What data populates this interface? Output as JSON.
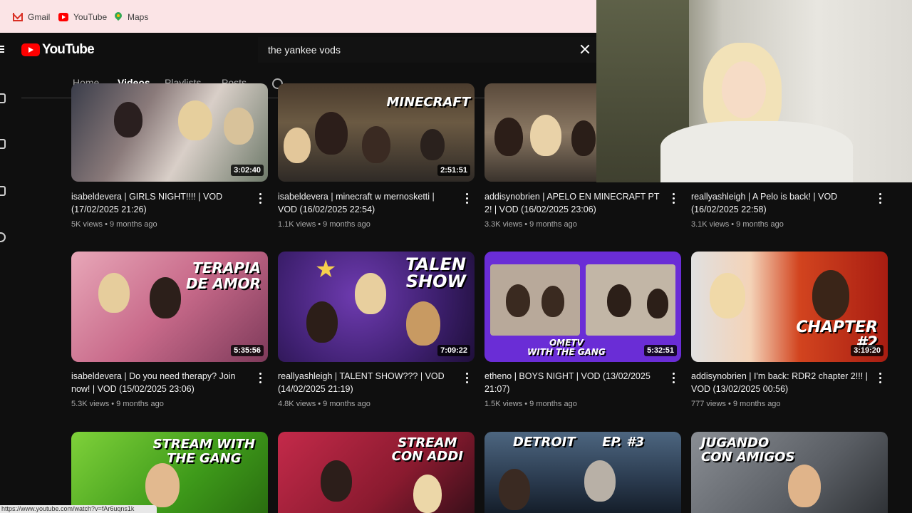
{
  "bookmarks": [
    {
      "label": "Gmail",
      "icon": "gmail-icon"
    },
    {
      "label": "YouTube",
      "icon": "youtube-icon"
    },
    {
      "label": "Maps",
      "icon": "maps-icon"
    }
  ],
  "header": {
    "logo_text": "YouTube",
    "search_value": "the yankee vods"
  },
  "tabs": [
    "Home",
    "Videos",
    "Playlists",
    "Posts"
  ],
  "active_tab": "Videos",
  "videos": [
    {
      "title": "isabeldevera | GIRLS NIGHT!!!! | VOD (17/02/2025 21:26)",
      "views": "5K views",
      "age": "9 months ago",
      "duration": "3:02:40",
      "thumb_text": ""
    },
    {
      "title": "isabeldevera | minecraft w mernosketti | VOD (16/02/2025 22:54)",
      "views": "1.1K views",
      "age": "9 months ago",
      "duration": "2:51:51",
      "thumb_text": "MINECRAFT"
    },
    {
      "title": "addisynobrien | APELO EN MINECRAFT PT 2! | VOD (16/02/2025 23:06)",
      "views": "3.3K views",
      "age": "9 months ago",
      "duration": "",
      "thumb_text": ""
    },
    {
      "title": "reallyashleigh | A Pelo is back! | VOD (16/02/2025 22:58)",
      "views": "3.1K views",
      "age": "9 months ago",
      "duration": "",
      "thumb_text": ""
    },
    {
      "title": "isabeldevera | Do you need therapy? Join now! | VOD (15/02/2025 23:06)",
      "views": "5.3K views",
      "age": "9 months ago",
      "duration": "5:35:56",
      "thumb_text": "TERAPIA\nDE AMOR"
    },
    {
      "title": "reallyashleigh | TALENT SHOW??? | VOD (14/02/2025 21:19)",
      "views": "4.8K views",
      "age": "9 months ago",
      "duration": "7:09:22",
      "thumb_text": "TALEN\nSHOW"
    },
    {
      "title": "etheno | BOYS NIGHT | VOD (13/02/2025 21:07)",
      "views": "1.5K views",
      "age": "9 months ago",
      "duration": "5:32:51",
      "thumb_text": "OMETV\nWITH THE GANG"
    },
    {
      "title": "addisynobrien | I'm back: RDR2 chapter 2!!! | VOD (13/02/2025 00:56)",
      "views": "777 views",
      "age": "9 months ago",
      "duration": "3:19:20",
      "thumb_text": "CHAPTER\n#2"
    },
    {
      "title": "",
      "views": "",
      "age": "",
      "duration": "",
      "thumb_text": "STREAM WITH\nTHE GANG"
    },
    {
      "title": "",
      "views": "",
      "age": "",
      "duration": "",
      "thumb_text": "STREAM\nCON ADDI"
    },
    {
      "title": "",
      "views": "",
      "age": "",
      "duration": "",
      "thumb_text": "DETROIT      EP. #3"
    },
    {
      "title": "",
      "views": "",
      "age": "",
      "duration": "",
      "thumb_text": "JUGANDO\nCON AMIGOS"
    }
  ],
  "status_url": "https://www.youtube.com/watch?v=fAr6uqns1k",
  "colors": {
    "brand": "#ff0000",
    "background": "#0f0f0f",
    "meta_text": "#aaaaaa"
  }
}
